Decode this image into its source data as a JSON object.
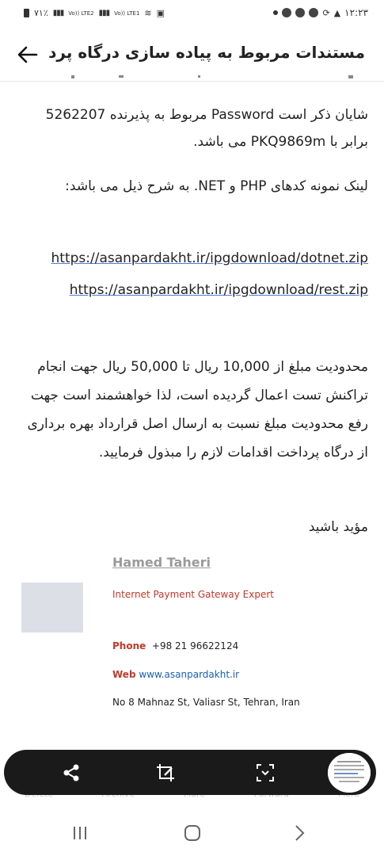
{
  "status_bar": {
    "left_text": "٧١٪",
    "sim1": "Vo)) LTE2",
    "sim2": "Vo)) LTE1",
    "time": "١٢:٢٣"
  },
  "app_bar": {
    "back_icon": "arrow-left-icon",
    "title": "مستندات مربوط به پیاده سازی درگاه پرد..."
  },
  "email": {
    "para1": "شایان ذکر است Password مربوط به پذیرنده  5262207 برابر با PKQ9869m می باشد.",
    "para2": "لینک نمونه کدهای PHP و NET. به شرح ذیل می باشد:",
    "links": [
      "https://asanpardakht.ir/ipgdownload/dotnet.zip",
      "https://asanpardakht.ir/ipgdownload/rest.zip"
    ],
    "para3": "محدودیت مبلغ از 10,000 ریال تا 50,000 ریال جهت انجام تراکنش تست اعمال گردیده است، لذا خواهشمند است جهت رفع محدودیت مبلغ نسبت به ارسال اصل قرارداد بهره برداری از درگاه پرداخت اقدامات لازم را مبذول فرمایید.",
    "closing": "مؤید باشید"
  },
  "signature": {
    "name": "Hamed Taheri",
    "role": "Internet Payment Gateway Expert",
    "phone_label": "Phone",
    "phone": "+98 21 96622124",
    "web_label": "Web",
    "web": "www.asanpardakht.ir",
    "address": "No 8 Mahnaz St, Valiasr St, Tehran, Iran"
  },
  "bottom_actions_faded": [
    "Delete",
    "Archive",
    "More",
    "Forward",
    "More"
  ],
  "toolbar": {
    "icons": [
      "share-icon",
      "crop-edit-icon",
      "scan-icon",
      "screenshot-thumbnail"
    ]
  },
  "colors": {
    "accent_red": "#c0392b",
    "link_blue": "#1a5fb4",
    "toolbar_bg": "#1a1a1a"
  }
}
